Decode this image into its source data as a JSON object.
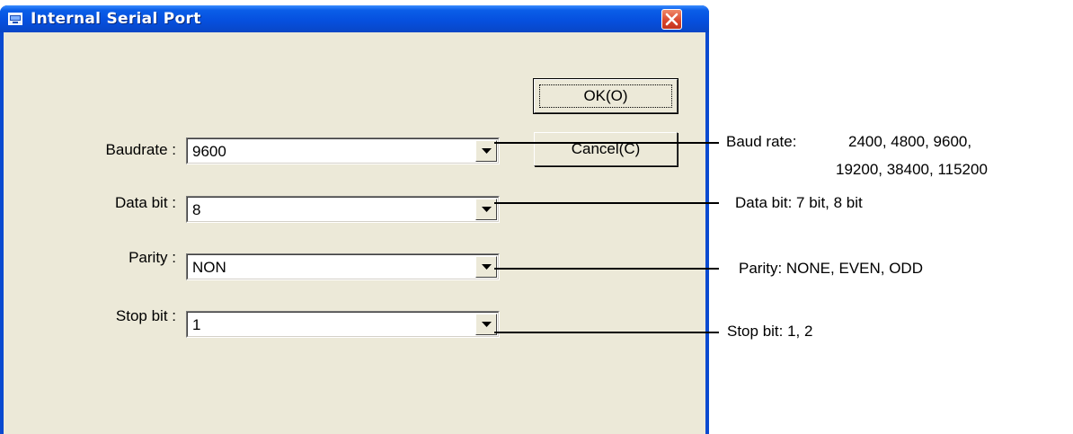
{
  "window": {
    "title": "Internal Serial Port",
    "icons": {
      "app": "serial-port-icon",
      "close": "close-icon"
    }
  },
  "form": {
    "baudrate": {
      "label": "Baudrate :",
      "value": "9600"
    },
    "data_bit": {
      "label": "Data bit :",
      "value": "8"
    },
    "parity": {
      "label": "Parity :",
      "value": "NON"
    },
    "stop_bit": {
      "label": "Stop bit :",
      "value": "1"
    }
  },
  "buttons": {
    "ok_label": "OK(O)",
    "cancel_label": "Cancel(C)"
  },
  "notes": {
    "baud_title": "Baud rate:",
    "baud_line1": "2400, 4800, 9600,",
    "baud_line2": "19200, 38400, 115200",
    "data_bit": "Data bit: 7 bit, 8 bit",
    "parity": "Parity: NONE, EVEN, ODD",
    "stop_bit": "Stop bit: 1, 2"
  },
  "colors": {
    "titlebar": "#0650df",
    "dialog_face": "#ece9d8",
    "close_button": "#d8432a"
  }
}
